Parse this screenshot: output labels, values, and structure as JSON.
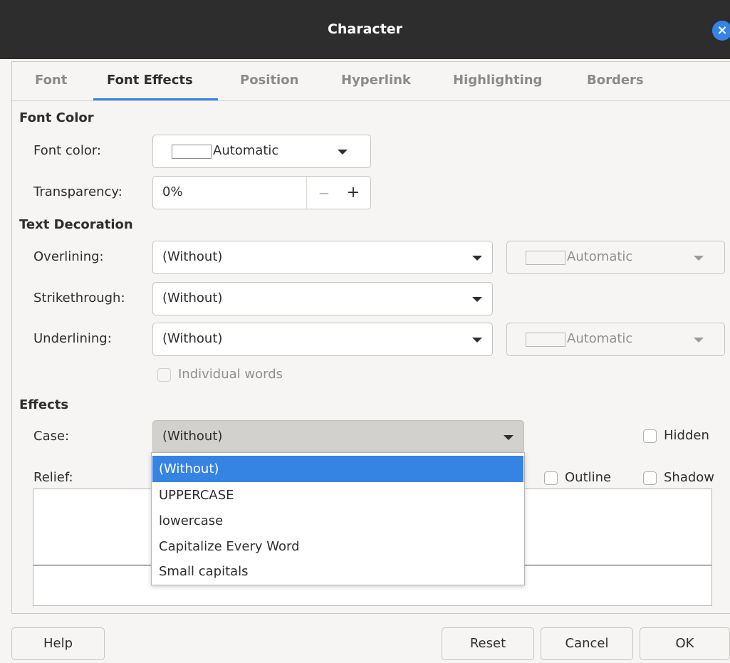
{
  "window": {
    "title": "Character"
  },
  "tabs": [
    {
      "label": "Font"
    },
    {
      "label": "Font Effects"
    },
    {
      "label": "Position"
    },
    {
      "label": "Hyperlink"
    },
    {
      "label": "Highlighting"
    },
    {
      "label": "Borders"
    }
  ],
  "active_tab": "Font Effects",
  "font_color_section": {
    "heading": "Font Color",
    "font_color_label": "Font color:",
    "font_color_value": "Automatic",
    "transparency_label": "Transparency:",
    "transparency_value": "0%",
    "minus": "−",
    "plus": "+"
  },
  "text_decoration": {
    "heading": "Text Decoration",
    "overlining_label": "Overlining:",
    "overlining_value": "(Without)",
    "overlining_color": "Automatic",
    "strikethrough_label": "Strikethrough:",
    "strikethrough_value": "(Without)",
    "underlining_label": "Underlining:",
    "underlining_value": "(Without)",
    "underlining_color": "Automatic",
    "individual_words_label": "Individual words"
  },
  "effects": {
    "heading": "Effects",
    "case_label": "Case:",
    "case_value": "(Without)",
    "relief_label": "Relief:",
    "hidden_label": "Hidden",
    "outline_label": "Outline",
    "shadow_label": "Shadow"
  },
  "case_dropdown": {
    "options": [
      "(Without)",
      "UPPERCASE",
      "lowercase",
      "Capitalize Every Word",
      "Small capitals"
    ],
    "selected": "(Without)"
  },
  "buttons": {
    "help": "Help",
    "reset": "Reset",
    "cancel": "Cancel",
    "ok": "OK"
  },
  "colors": {
    "accent": "#3584e4",
    "titlebar": "#2d2d2d",
    "background": "#f6f5f4"
  }
}
